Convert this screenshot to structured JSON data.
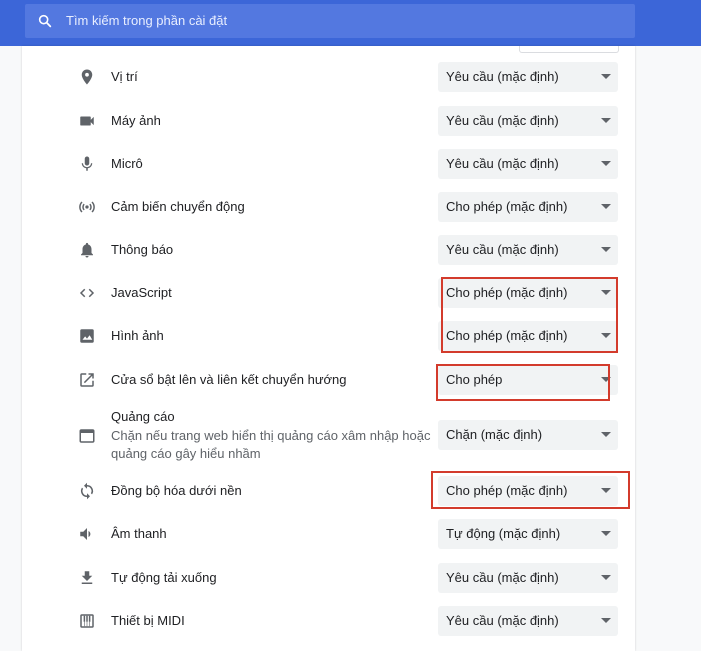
{
  "search": {
    "placeholder": "Tìm kiếm trong phần cài đặt"
  },
  "colors": {
    "header": "#3c66d8",
    "highlight": "#d33b2c",
    "select_bg": "#f1f3f4"
  },
  "rows": [
    {
      "icon": "location-pin-icon",
      "label": "Vị trí",
      "value": "Yêu cầu (mặc định)"
    },
    {
      "icon": "camera-icon",
      "label": "Máy ảnh",
      "value": "Yêu cầu (mặc định)"
    },
    {
      "icon": "microphone-icon",
      "label": "Micrô",
      "value": "Yêu cầu (mặc định)"
    },
    {
      "icon": "motion-sensor-icon",
      "label": "Cảm biến chuyển động",
      "value": "Cho phép (mặc định)"
    },
    {
      "icon": "bell-icon",
      "label": "Thông báo",
      "value": "Yêu cầu (mặc định)"
    },
    {
      "icon": "code-brackets-icon",
      "label": "JavaScript",
      "value": "Cho phép (mặc định)"
    },
    {
      "icon": "image-icon",
      "label": "Hình ảnh",
      "value": "Cho phép (mặc định)"
    },
    {
      "icon": "open-in-new-icon",
      "label": "Cửa sổ bật lên và liên kết chuyển hướng",
      "value": "Cho phép"
    },
    {
      "icon": "ads-window-icon",
      "label": "Quảng cáo",
      "description_line1": "Chặn nếu trang web hiển thị quảng cáo xâm nhập hoặc",
      "description_line2": "quảng cáo gây hiểu nhầm",
      "value": "Chặn (mặc định)"
    },
    {
      "icon": "sync-icon",
      "label": "Đồng bộ hóa dưới nền",
      "value": "Cho phép (mặc định)"
    },
    {
      "icon": "speaker-icon",
      "label": "Âm thanh",
      "value": "Tự động (mặc định)"
    },
    {
      "icon": "download-icon",
      "label": "Tự động tải xuống",
      "value": "Yêu cầu (mặc định)"
    },
    {
      "icon": "piano-icon",
      "label": "Thiết bị MIDI",
      "value": "Yêu cầu (mặc định)"
    }
  ]
}
